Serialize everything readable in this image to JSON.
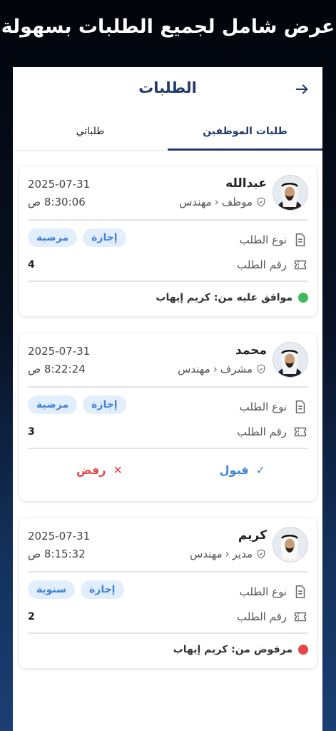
{
  "headline": "عرض شامل لجميع الطلبات بسهولة",
  "page_title": "الطلبات",
  "tabs": {
    "employees": "طلبات الموظفين",
    "mine": "طلباتي"
  },
  "labels": {
    "request_type": "نوع الطلب",
    "request_number": "رقم الطلب",
    "accept": "قبول",
    "reject": "رفض"
  },
  "colors": {
    "primary": "#1f3a68",
    "accent": "#3f84d8",
    "approved": "#3dbb5a",
    "rejected": "#e84545"
  },
  "requests": [
    {
      "name": "عبدالله",
      "position": "موظف",
      "job": "مهندس",
      "date": "2025-07-31",
      "time": "8:30:06 ص",
      "type_tags": [
        "إجازة",
        "مرضية"
      ],
      "number": "4",
      "status_text": "موافق عليه من: كريم إيهاب",
      "status": "approved"
    },
    {
      "name": "محمد",
      "position": "مشرف",
      "job": "مهندس",
      "date": "2025-07-31",
      "time": "8:22:24 ص",
      "type_tags": [
        "إجازة",
        "مرضية"
      ],
      "number": "3",
      "status": "pending"
    },
    {
      "name": "كريم",
      "position": "مدير",
      "job": "مهندس",
      "date": "2025-07-31",
      "time": "8:15:32 ص",
      "type_tags": [
        "إجازة",
        "سنوية"
      ],
      "number": "2",
      "status_text": "مرفوض من: كريم إيهاب",
      "status": "rejected"
    }
  ]
}
